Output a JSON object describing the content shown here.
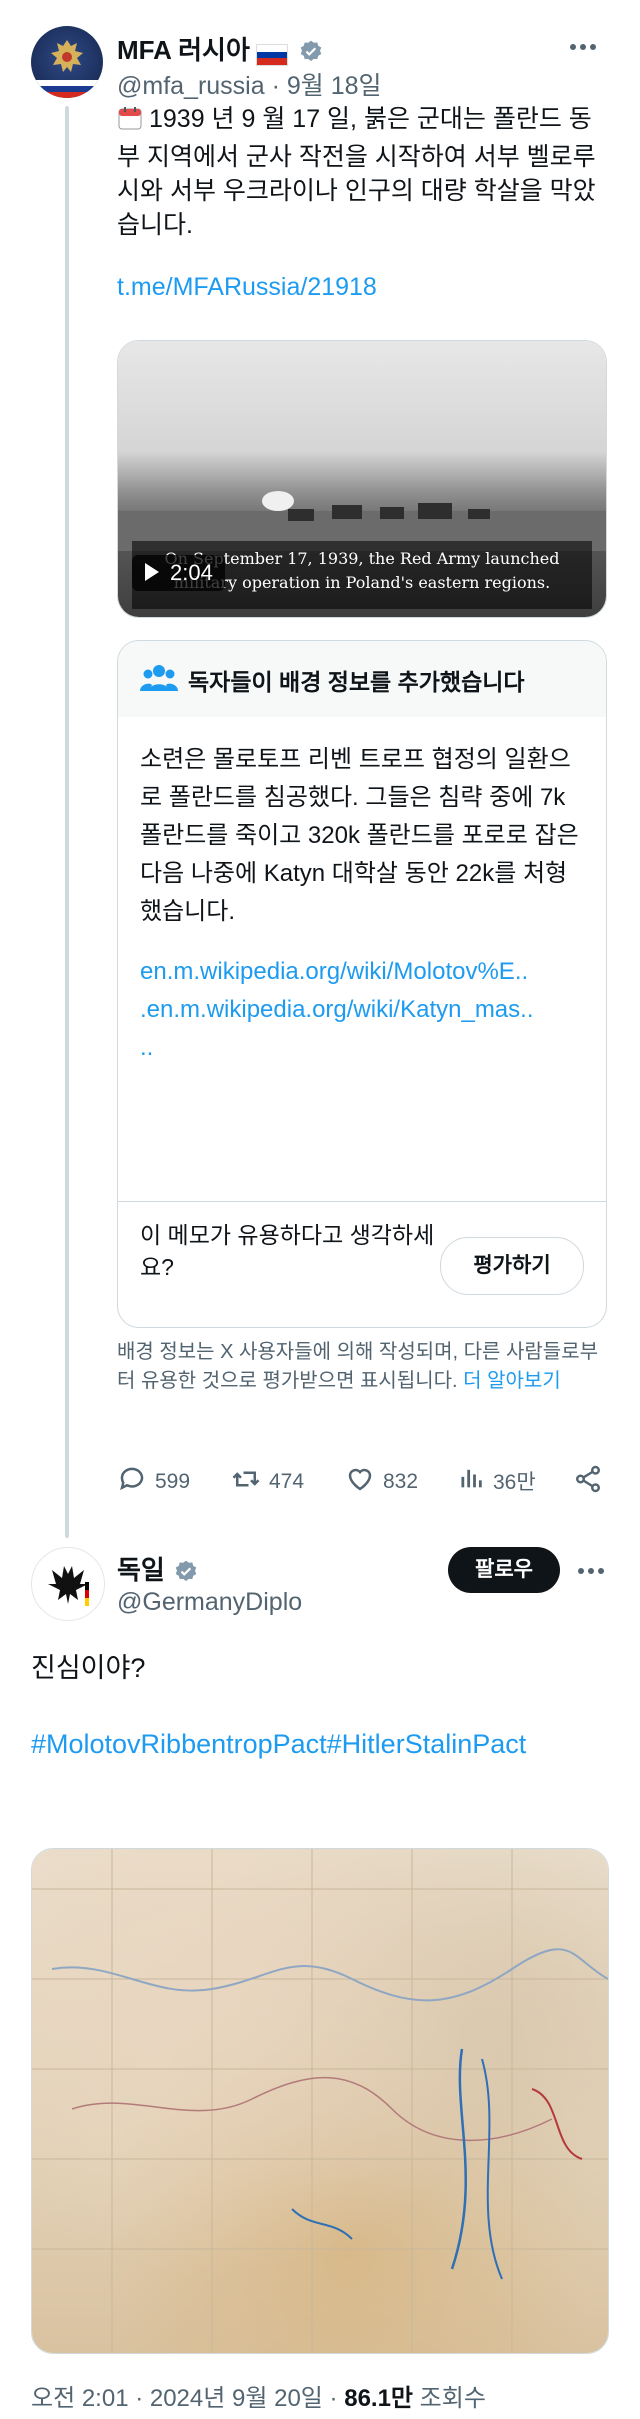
{
  "tweet1": {
    "name": "MFA 러시아",
    "handle": "@mfa_russia",
    "date": "9월 18일",
    "text": "1939 년 9 월 17 일, 붉은 군대는 폴란드 동부 지역에서 군사 작전을 시작하여 서부 벨로루시와 서부 우크라이나 인구의 대량 학살을 막았습니다.",
    "link": "t.me/MFARussia/21918",
    "video": {
      "duration": "2:04",
      "caption": "On September 17, 1939, the Red Army launched military operation in Poland's eastern regions."
    },
    "note": {
      "title": "독자들이 배경 정보를 추가했습니다",
      "text": "소련은 몰로토프 리벤 트로프 협정의 일환으로 폴란드를 침공했다. 그들은 침략 중에 7k 폴란드를 죽이고 320k 폴란드를 포로로 잡은 다음 나중에 Katyn 대학살 동안 22k를 처형했습니다.",
      "link1": "en.m.wikipedia.org/wiki/Molotov%E..",
      "link2": ".en.m.wikipedia.org/wiki/Katyn_mas..",
      "link3": "..",
      "question": "이 메모가 유용하다고 생각하세요?",
      "rate_label": "평가하기"
    },
    "footer_text": "배경 정보는 X 사용자들에 의해 작성되며, 다른 사람들로부터 유용한 것으로 평가받으면 표시됩니다.",
    "footer_link": "더 알아보기",
    "stats": {
      "replies": "599",
      "reposts": "474",
      "likes": "832",
      "views": "36만"
    }
  },
  "tweet2": {
    "name": "독일",
    "handle": "@GermanyDiplo",
    "follow_label": "팔로우",
    "text": "진심이야?",
    "hashtags": "#MolotovRibbentropPact#HitlerStalinPact",
    "timestamp": "오전 2:01 · 2024년 9월 20일 · ",
    "views": "86.1만",
    "views_suffix": " 조회수"
  },
  "icons": {
    "verified": "verified-badge-icon",
    "more": "more-icon",
    "calendar": "calendar-icon",
    "people": "people-icon",
    "play": "play-icon",
    "reply": "reply-icon",
    "repost": "repost-icon",
    "like": "like-icon",
    "views": "views-icon",
    "share": "share-icon"
  },
  "colors": {
    "link": "#1d9bf0",
    "muted": "#536471",
    "verified": "#829aab",
    "follow_bg": "#0f1419"
  }
}
